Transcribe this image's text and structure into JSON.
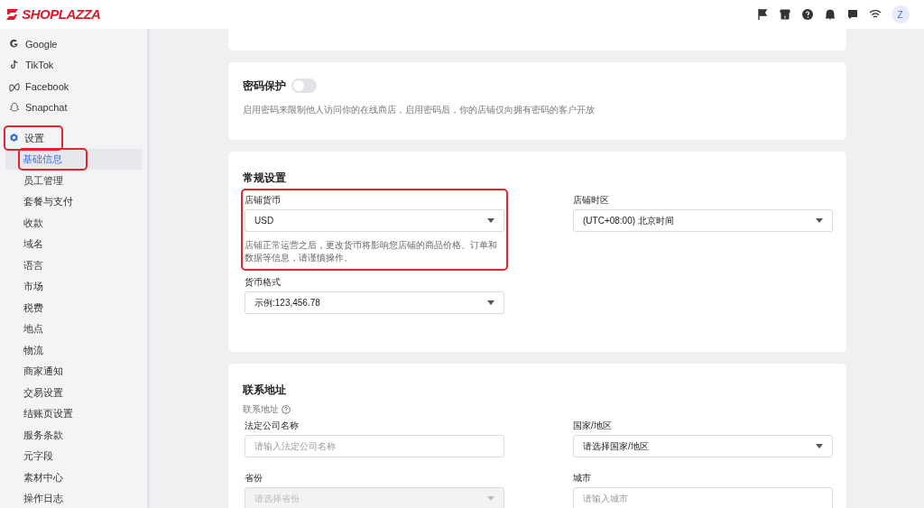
{
  "header": {
    "logo": "SHOPLAZZA",
    "avatar": "Z"
  },
  "sidebar": {
    "channels": [
      {
        "label": "Google",
        "kind": "google"
      },
      {
        "label": "TikTok",
        "kind": "tiktok"
      },
      {
        "label": "Facebook",
        "kind": "meta"
      },
      {
        "label": "Snapchat",
        "kind": "snapchat"
      }
    ],
    "settings": {
      "label": "设置",
      "highlighted": true,
      "children": [
        {
          "label": "基础信息",
          "selected": true,
          "highlighted": true
        },
        {
          "label": "员工管理",
          "selected": false,
          "highlighted": false
        },
        {
          "label": "套餐与支付",
          "selected": false,
          "highlighted": false
        },
        {
          "label": "收款",
          "selected": false,
          "highlighted": false
        },
        {
          "label": "域名",
          "selected": false,
          "highlighted": false
        },
        {
          "label": "语言",
          "selected": false,
          "highlighted": false
        },
        {
          "label": "市场",
          "selected": false,
          "highlighted": false
        },
        {
          "label": "税费",
          "selected": false,
          "highlighted": false
        },
        {
          "label": "地点",
          "selected": false,
          "highlighted": false
        },
        {
          "label": "物流",
          "selected": false,
          "highlighted": false
        },
        {
          "label": "商家通知",
          "selected": false,
          "highlighted": false
        },
        {
          "label": "交易设置",
          "selected": false,
          "highlighted": false
        },
        {
          "label": "结账页设置",
          "selected": false,
          "highlighted": false
        },
        {
          "label": "服务条款",
          "selected": false,
          "highlighted": false
        },
        {
          "label": "元字段",
          "selected": false,
          "highlighted": false
        },
        {
          "label": "素材中心",
          "selected": false,
          "highlighted": false
        },
        {
          "label": "操作日志",
          "selected": false,
          "highlighted": false
        }
      ]
    }
  },
  "password_card": {
    "title": "密码保护",
    "on": false,
    "description": "启用密码来限制他人访问你的在线商店，启用密码后，你的店铺仅向拥有密码的客户开放"
  },
  "general_card": {
    "title": "常规设置",
    "fields": [
      {
        "kind": "select",
        "label": "店铺货币",
        "value": "USD",
        "note": "店铺正常运营之后，更改货币将影响您店铺的商品价格、订单和数据等信息，请谨慎操作。",
        "highlighted": true
      },
      {
        "kind": "select",
        "label": "店铺时区",
        "value": "(UTC+08:00) 北京时间",
        "highlighted": false
      },
      {
        "kind": "select",
        "label": "货币格式",
        "value": "示例:123,456.78",
        "highlighted": false
      }
    ]
  },
  "address_card": {
    "title": "联系地址",
    "subtitle": "联系地址",
    "fields": [
      {
        "kind": "input",
        "label": "法定公司名称",
        "placeholder": "请输入法定公司名称"
      },
      {
        "kind": "select",
        "label": "国家/地区",
        "value": "请选择国家/地区"
      },
      {
        "kind": "select",
        "label": "省份",
        "placeholder": "请选择省份",
        "disabled": true
      },
      {
        "kind": "input",
        "label": "城市",
        "placeholder": "请输入城市"
      }
    ]
  }
}
